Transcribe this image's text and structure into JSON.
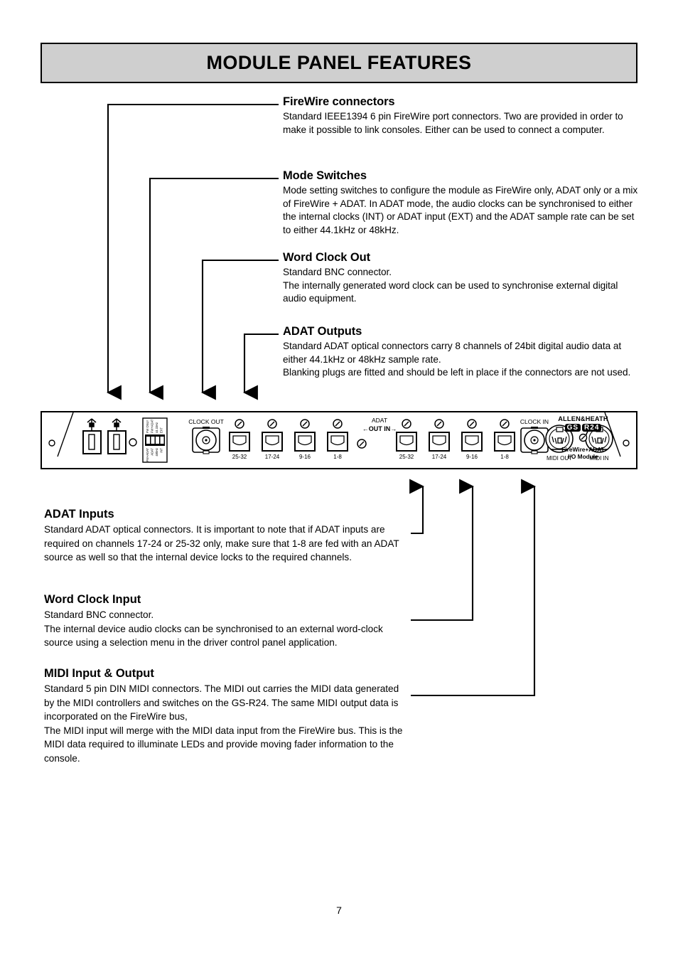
{
  "header": {
    "title": "MODULE PANEL FEATURES"
  },
  "callouts_top": [
    {
      "title": "FireWire connectors",
      "body": "Standard IEEE1394 6 pin FireWire port connectors. Two are provided in order to make it possible to link consoles. Either can be used to connect a computer."
    },
    {
      "title": "Mode Switches",
      "body": "Mode setting switches to configure the module as FireWire only, ADAT only or a mix of FireWire + ADAT. In ADAT mode, the audio clocks can be synchronised to either the internal clocks (INT) or ADAT input (EXT) and the ADAT sample rate can be set to either 44.1kHz or 48kHz."
    },
    {
      "title": "Word Clock Out",
      "body": "Standard BNC connector.\nThe internally generated word clock can be used to synchronise external digital audio equipment."
    },
    {
      "title": "ADAT Outputs",
      "body": "Standard ADAT optical connectors carry 8 channels of 24bit digital audio data at either 44.1kHz or 48kHz sample rate.\nBlanking plugs are fitted and should be left in place if the connectors are not used."
    }
  ],
  "callouts_bottom": [
    {
      "title": "ADAT Inputs",
      "body": "Standard ADAT optical connectors. It is important to note that if ADAT inputs are required on channels 17-24 or 25-32 only, make sure that 1-8 are fed with an ADAT source as well so that the internal device locks to the required channels."
    },
    {
      "title": "Word Clock Input",
      "body": "Standard BNC connector.\nThe internal device audio clocks can be synchronised to an external word-clock  source using a selection menu in the driver control panel application."
    },
    {
      "title": "MIDI Input & Output",
      "body": "Standard 5 pin DIN MIDI connectors. The MIDI out carries the MIDI data generated by the MIDI controllers and switches on the GS-R24. The same MIDI output data is incorporated on the FireWire bus,\nThe MIDI input will merge with the MIDI data input from the FireWire bus. This is the MIDI data required to illuminate LEDs and provide moving fader information to the console."
    }
  ],
  "panel": {
    "clock_out_label": "CLOCK OUT",
    "clock_in_label": "CLOCK IN",
    "adat_label": "ADAT",
    "adat_out_label": "OUT",
    "adat_in_label": "IN",
    "adat_out_arrow": "←",
    "adat_in_arrow": "→",
    "adat_out_channels": [
      "25-32",
      "17-24",
      "9-16",
      "1-8"
    ],
    "adat_in_channels": [
      "25-32",
      "17-24",
      "9-16",
      "1-8"
    ],
    "midi_out_label": "MIDI OUT",
    "midi_in_label": "MIDI IN",
    "brand": "ALLEN&HEATH",
    "model_left": "GS",
    "model_right": "R24",
    "module_line1": "FireWire+ADAT",
    "module_line2": "I/O Module",
    "dip_top_labels": [
      "FW ONLY",
      "FW+ADAT",
      "44.1kHz",
      "EXT"
    ],
    "dip_bottom_labels": [
      "FW+ADAT",
      "ADAT",
      "48kHz",
      "INT"
    ]
  },
  "footer": {
    "page_number": "7"
  },
  "colors": {
    "banner_fill": "#cfcfcf",
    "line": "#000000",
    "page_background": "#ffffff"
  }
}
